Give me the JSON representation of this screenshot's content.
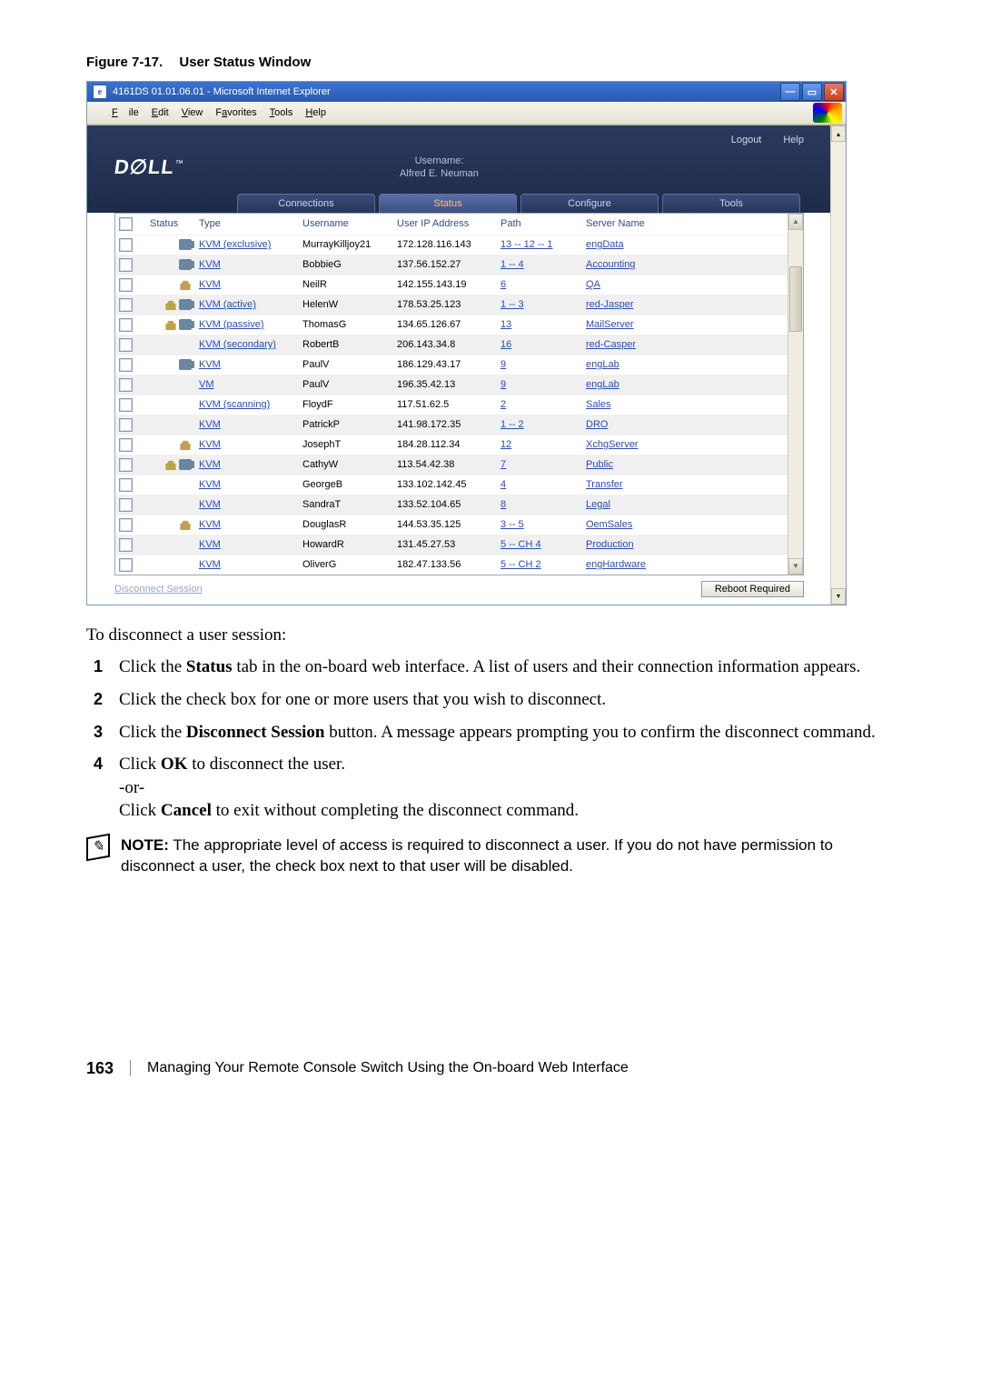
{
  "figure": {
    "caption_num": "Figure 7-17.",
    "caption_title": "User Status Window"
  },
  "window": {
    "title": "4161DS 01.01.06.01 - Microsoft Internet Explorer",
    "menu": [
      "File",
      "Edit",
      "View",
      "Favorites",
      "Tools",
      "Help"
    ]
  },
  "header_links": {
    "logout": "Logout",
    "help": "Help"
  },
  "user_box": {
    "label": "Username:",
    "name": "Alfred E. Neuman"
  },
  "tabs": {
    "items": [
      "Connections",
      "Status",
      "Configure",
      "Tools"
    ],
    "active_index": 1
  },
  "table": {
    "columns": [
      "",
      "Status",
      "Type",
      "Username",
      "User IP Address",
      "Path",
      "Server Name"
    ],
    "rows": [
      {
        "icons": [
          "media"
        ],
        "type": "KVM (exclusive)",
        "user": "MurrayKilljoy21",
        "ip": "172.128.116.143",
        "path": "13 -- 12 -- 1",
        "server": "engData"
      },
      {
        "icons": [
          "media"
        ],
        "type": "KVM",
        "user": "BobbieG",
        "ip": "137.56.152.27",
        "path": "1 -- 4",
        "server": "Accounting"
      },
      {
        "icons": [
          "lock"
        ],
        "type": "KVM",
        "user": "NeilR",
        "ip": "142.155.143.19",
        "path": "6",
        "server": "QA"
      },
      {
        "icons": [
          "lock",
          "media"
        ],
        "type": "KVM (active)",
        "user": "HelenW",
        "ip": "178.53.25.123",
        "path": "1 -- 3",
        "server": "red-Jasper"
      },
      {
        "icons": [
          "lock",
          "media"
        ],
        "type": "KVM (passive)",
        "user": "ThomasG",
        "ip": "134.65.126.67",
        "path": "13",
        "server": "MailServer"
      },
      {
        "icons": [],
        "type": "KVM (secondary)",
        "user": "RobertB",
        "ip": "206.143.34.8",
        "path": "16",
        "server": "red-Casper"
      },
      {
        "icons": [
          "media"
        ],
        "type": "KVM",
        "user": "PaulV",
        "ip": "186.129.43.17",
        "path": "9",
        "server": "engLab"
      },
      {
        "icons": [],
        "type": "VM",
        "user": "PaulV",
        "ip": "196.35.42.13",
        "path": "9",
        "server": "engLab"
      },
      {
        "icons": [],
        "type": "KVM (scanning)",
        "user": "FloydF",
        "ip": "117.51.62.5",
        "path": "2",
        "server": "Sales"
      },
      {
        "icons": [],
        "type": "KVM",
        "user": "PatrickP",
        "ip": "141.98.172.35",
        "path": "1 -- 2",
        "server": "DRO"
      },
      {
        "icons": [
          "lock"
        ],
        "type": "KVM",
        "user": "JosephT",
        "ip": "184.28.112.34",
        "path": "12",
        "server": "XchgServer"
      },
      {
        "icons": [
          "lock",
          "media"
        ],
        "type": "KVM",
        "user": "CathyW",
        "ip": "113.54.42.38",
        "path": "7",
        "server": "Public"
      },
      {
        "icons": [],
        "type": "KVM",
        "user": "GeorgeB",
        "ip": "133.102.142.45",
        "path": "4",
        "server": "Transfer"
      },
      {
        "icons": [],
        "type": "KVM",
        "user": "SandraT",
        "ip": "133.52.104.65",
        "path": "8",
        "server": "Legal"
      },
      {
        "icons": [
          "lock"
        ],
        "type": "KVM",
        "user": "DouglasR",
        "ip": "144.53.35.125",
        "path": "3 -- 5",
        "server": "OemSales"
      },
      {
        "icons": [],
        "type": "KVM",
        "user": "HowardR",
        "ip": "131.45.27.53",
        "path": "5 -- CH 4",
        "server": "Production"
      },
      {
        "icons": [],
        "type": "KVM",
        "user": "OliverG",
        "ip": "182.47.133.56",
        "path": "5 -- CH 2",
        "server": "engHardware"
      }
    ]
  },
  "buttons": {
    "disconnect": "Disconnect Session",
    "reboot": "Reboot Required"
  },
  "body": {
    "intro": "To disconnect a user session:",
    "steps": [
      "Click the Status tab in the on-board web interface. A list of users and their connection information appears.",
      "Click the check box for one or more users that you wish to disconnect.",
      "Click the Disconnect Session button. A message appears prompting you to confirm the disconnect command.",
      "Click OK to disconnect the user.\n-or-\nClick Cancel to exit without completing the disconnect command."
    ],
    "step_bold": {
      "0": "Status",
      "2": "Disconnect Session",
      "3a": "OK",
      "3b": "Cancel"
    },
    "note_label": "NOTE:",
    "note_text": "The appropriate level of access is required to disconnect a user. If you do not have permission to disconnect a user, the check box next to that user will be disabled."
  },
  "footer": {
    "page": "163",
    "chapter": "Managing Your Remote Console Switch Using the On-board Web Interface"
  }
}
